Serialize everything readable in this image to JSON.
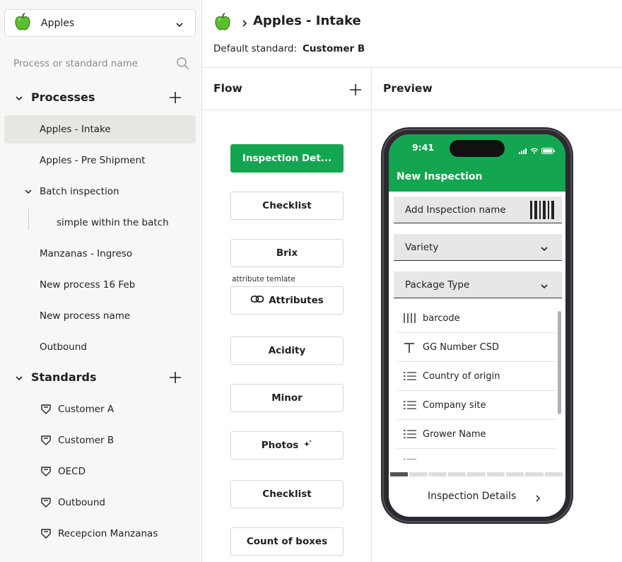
{
  "sidebar": {
    "crop_select": {
      "label": "Apples",
      "icon": "apple-icon"
    },
    "search_placeholder": "Process or standard name",
    "processes": {
      "title": "Processes",
      "items": [
        {
          "label": "Apples - Intake"
        },
        {
          "label": "Apples - Pre Shipment"
        },
        {
          "label": "Batch inspection"
        },
        {
          "label": "simple within the batch"
        },
        {
          "label": "Manzanas - Ingreso"
        },
        {
          "label": "New process 16 Feb"
        },
        {
          "label": "New process name"
        },
        {
          "label": "Outbound"
        }
      ]
    },
    "standards": {
      "title": "Standards",
      "items": [
        {
          "label": "Customer A"
        },
        {
          "label": "Customer B"
        },
        {
          "label": "OECD"
        },
        {
          "label": "Outbound"
        },
        {
          "label": "Recepcion Manzanas"
        }
      ]
    }
  },
  "header": {
    "title": "Apples - Intake",
    "default_standard_label": "Default standard:",
    "default_standard_value": "Customer B"
  },
  "flow": {
    "title": "Flow",
    "note": "attribute temlate",
    "steps": [
      {
        "label": "Inspection Det..."
      },
      {
        "label": "Checklist"
      },
      {
        "label": "Brix"
      },
      {
        "label": "Attributes"
      },
      {
        "label": "Acidity"
      },
      {
        "label": "Minor"
      },
      {
        "label": "Photos"
      },
      {
        "label": "Checklist"
      },
      {
        "label": "Count of boxes"
      }
    ]
  },
  "preview": {
    "title": "Preview",
    "phone": {
      "time": "9:41",
      "app_title": "New Inspection",
      "fields": [
        {
          "label": "Add Inspection name"
        },
        {
          "label": "Variety"
        },
        {
          "label": "Package Type"
        }
      ],
      "list": [
        {
          "label": "barcode",
          "icon": "barcode-icon"
        },
        {
          "label": "GG Number CSD",
          "icon": "text-icon"
        },
        {
          "label": "Country of origin",
          "icon": "list-icon"
        },
        {
          "label": "Company site",
          "icon": "list-icon"
        },
        {
          "label": "Grower Name",
          "icon": "list-icon"
        }
      ],
      "footer_label": "Inspection Details"
    }
  },
  "colors": {
    "accent": "#14a550",
    "active_bg": "#e8e6e3"
  }
}
